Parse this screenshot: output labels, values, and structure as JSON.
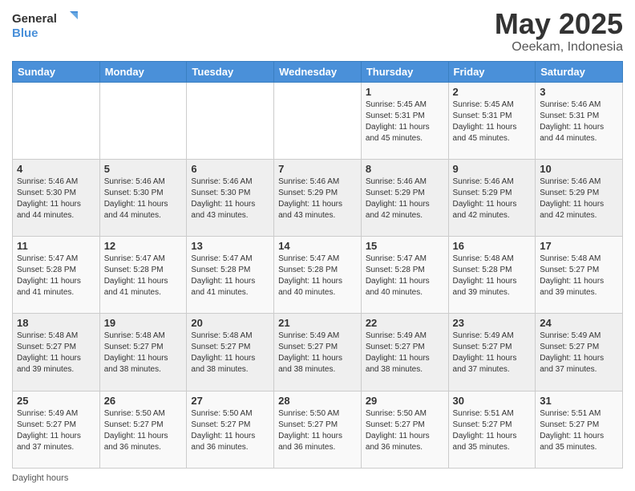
{
  "header": {
    "logo_line1": "General",
    "logo_line2": "Blue",
    "title": "May 2025",
    "subtitle": "Oeekam, Indonesia"
  },
  "days_of_week": [
    "Sunday",
    "Monday",
    "Tuesday",
    "Wednesday",
    "Thursday",
    "Friday",
    "Saturday"
  ],
  "weeks": [
    [
      {
        "day": "",
        "info": ""
      },
      {
        "day": "",
        "info": ""
      },
      {
        "day": "",
        "info": ""
      },
      {
        "day": "",
        "info": ""
      },
      {
        "day": "1",
        "info": "Sunrise: 5:45 AM\nSunset: 5:31 PM\nDaylight: 11 hours and 45 minutes."
      },
      {
        "day": "2",
        "info": "Sunrise: 5:45 AM\nSunset: 5:31 PM\nDaylight: 11 hours and 45 minutes."
      },
      {
        "day": "3",
        "info": "Sunrise: 5:46 AM\nSunset: 5:31 PM\nDaylight: 11 hours and 44 minutes."
      }
    ],
    [
      {
        "day": "4",
        "info": "Sunrise: 5:46 AM\nSunset: 5:30 PM\nDaylight: 11 hours and 44 minutes."
      },
      {
        "day": "5",
        "info": "Sunrise: 5:46 AM\nSunset: 5:30 PM\nDaylight: 11 hours and 44 minutes."
      },
      {
        "day": "6",
        "info": "Sunrise: 5:46 AM\nSunset: 5:30 PM\nDaylight: 11 hours and 43 minutes."
      },
      {
        "day": "7",
        "info": "Sunrise: 5:46 AM\nSunset: 5:29 PM\nDaylight: 11 hours and 43 minutes."
      },
      {
        "day": "8",
        "info": "Sunrise: 5:46 AM\nSunset: 5:29 PM\nDaylight: 11 hours and 42 minutes."
      },
      {
        "day": "9",
        "info": "Sunrise: 5:46 AM\nSunset: 5:29 PM\nDaylight: 11 hours and 42 minutes."
      },
      {
        "day": "10",
        "info": "Sunrise: 5:46 AM\nSunset: 5:29 PM\nDaylight: 11 hours and 42 minutes."
      }
    ],
    [
      {
        "day": "11",
        "info": "Sunrise: 5:47 AM\nSunset: 5:28 PM\nDaylight: 11 hours and 41 minutes."
      },
      {
        "day": "12",
        "info": "Sunrise: 5:47 AM\nSunset: 5:28 PM\nDaylight: 11 hours and 41 minutes."
      },
      {
        "day": "13",
        "info": "Sunrise: 5:47 AM\nSunset: 5:28 PM\nDaylight: 11 hours and 41 minutes."
      },
      {
        "day": "14",
        "info": "Sunrise: 5:47 AM\nSunset: 5:28 PM\nDaylight: 11 hours and 40 minutes."
      },
      {
        "day": "15",
        "info": "Sunrise: 5:47 AM\nSunset: 5:28 PM\nDaylight: 11 hours and 40 minutes."
      },
      {
        "day": "16",
        "info": "Sunrise: 5:48 AM\nSunset: 5:28 PM\nDaylight: 11 hours and 39 minutes."
      },
      {
        "day": "17",
        "info": "Sunrise: 5:48 AM\nSunset: 5:27 PM\nDaylight: 11 hours and 39 minutes."
      }
    ],
    [
      {
        "day": "18",
        "info": "Sunrise: 5:48 AM\nSunset: 5:27 PM\nDaylight: 11 hours and 39 minutes."
      },
      {
        "day": "19",
        "info": "Sunrise: 5:48 AM\nSunset: 5:27 PM\nDaylight: 11 hours and 38 minutes."
      },
      {
        "day": "20",
        "info": "Sunrise: 5:48 AM\nSunset: 5:27 PM\nDaylight: 11 hours and 38 minutes."
      },
      {
        "day": "21",
        "info": "Sunrise: 5:49 AM\nSunset: 5:27 PM\nDaylight: 11 hours and 38 minutes."
      },
      {
        "day": "22",
        "info": "Sunrise: 5:49 AM\nSunset: 5:27 PM\nDaylight: 11 hours and 38 minutes."
      },
      {
        "day": "23",
        "info": "Sunrise: 5:49 AM\nSunset: 5:27 PM\nDaylight: 11 hours and 37 minutes."
      },
      {
        "day": "24",
        "info": "Sunrise: 5:49 AM\nSunset: 5:27 PM\nDaylight: 11 hours and 37 minutes."
      }
    ],
    [
      {
        "day": "25",
        "info": "Sunrise: 5:49 AM\nSunset: 5:27 PM\nDaylight: 11 hours and 37 minutes."
      },
      {
        "day": "26",
        "info": "Sunrise: 5:50 AM\nSunset: 5:27 PM\nDaylight: 11 hours and 36 minutes."
      },
      {
        "day": "27",
        "info": "Sunrise: 5:50 AM\nSunset: 5:27 PM\nDaylight: 11 hours and 36 minutes."
      },
      {
        "day": "28",
        "info": "Sunrise: 5:50 AM\nSunset: 5:27 PM\nDaylight: 11 hours and 36 minutes."
      },
      {
        "day": "29",
        "info": "Sunrise: 5:50 AM\nSunset: 5:27 PM\nDaylight: 11 hours and 36 minutes."
      },
      {
        "day": "30",
        "info": "Sunrise: 5:51 AM\nSunset: 5:27 PM\nDaylight: 11 hours and 35 minutes."
      },
      {
        "day": "31",
        "info": "Sunrise: 5:51 AM\nSunset: 5:27 PM\nDaylight: 11 hours and 35 minutes."
      }
    ]
  ],
  "footer": {
    "daylight_label": "Daylight hours"
  }
}
